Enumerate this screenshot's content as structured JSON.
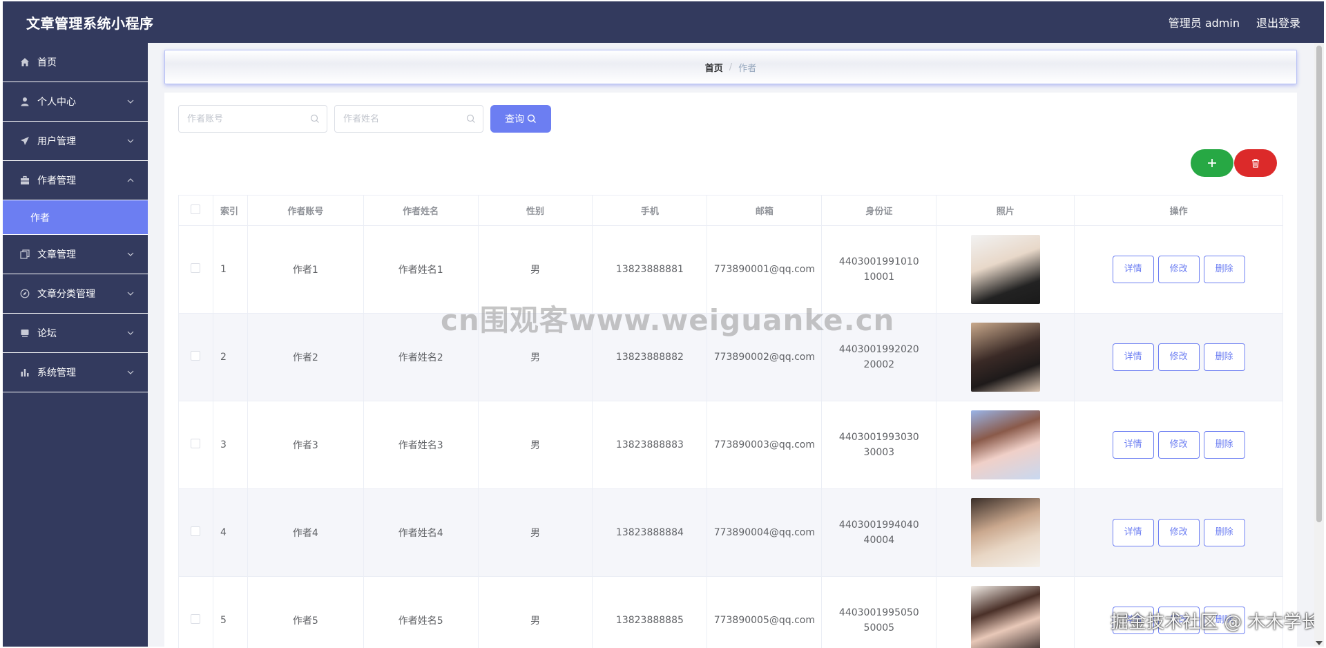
{
  "header": {
    "app_title": "文章管理系统小程序",
    "admin_label": "管理员 admin",
    "logout_label": "退出登录"
  },
  "sidebar": {
    "items": [
      {
        "label": "首页",
        "icon": "home-icon",
        "has_chevron": false
      },
      {
        "label": "个人中心",
        "icon": "user-icon",
        "has_chevron": true,
        "expanded": false
      },
      {
        "label": "用户管理",
        "icon": "paper-plane-icon",
        "has_chevron": true,
        "expanded": false
      },
      {
        "label": "作者管理",
        "icon": "briefcase-icon",
        "has_chevron": true,
        "expanded": true
      },
      {
        "label": "文章管理",
        "icon": "copy-icon",
        "has_chevron": true,
        "expanded": false
      },
      {
        "label": "文章分类管理",
        "icon": "compass-icon",
        "has_chevron": true,
        "expanded": false
      },
      {
        "label": "论坛",
        "icon": "stack-icon",
        "has_chevron": true,
        "expanded": false
      },
      {
        "label": "系统管理",
        "icon": "bar-chart-icon",
        "has_chevron": true,
        "expanded": false
      }
    ],
    "active_sub_item": "作者"
  },
  "breadcrumb": {
    "home": "首页",
    "separator": "/",
    "current": "作者"
  },
  "search": {
    "account_placeholder": "作者账号",
    "name_placeholder": "作者姓名",
    "query_label": "查询"
  },
  "table": {
    "columns": [
      "索引",
      "作者账号",
      "作者姓名",
      "性别",
      "手机",
      "邮箱",
      "身份证",
      "照片",
      "操作"
    ],
    "rows": [
      {
        "index": "1",
        "account": "作者1",
        "name": "作者姓名1",
        "gender": "男",
        "phone": "13823888881",
        "email": "773890001@qq.com",
        "id_card": "440300199101010001"
      },
      {
        "index": "2",
        "account": "作者2",
        "name": "作者姓名2",
        "gender": "男",
        "phone": "13823888882",
        "email": "773890002@qq.com",
        "id_card": "440300199202020002"
      },
      {
        "index": "3",
        "account": "作者3",
        "name": "作者姓名3",
        "gender": "男",
        "phone": "13823888883",
        "email": "773890003@qq.com",
        "id_card": "440300199303030003"
      },
      {
        "index": "4",
        "account": "作者4",
        "name": "作者姓名4",
        "gender": "男",
        "phone": "13823888884",
        "email": "773890004@qq.com",
        "id_card": "440300199404040004"
      },
      {
        "index": "5",
        "account": "作者5",
        "name": "作者姓名5",
        "gender": "男",
        "phone": "13823888885",
        "email": "773890005@qq.com",
        "id_card": "440300199505050005"
      }
    ],
    "actions": {
      "detail": "详情",
      "edit": "修改",
      "delete": "删除"
    }
  },
  "watermarks": {
    "center": "cn围观客www.weiguanke.cn",
    "corner": "掘金技术社区 @ 木木学长"
  },
  "colors": {
    "header_bg": "#333a5e",
    "sidebar_bg": "#333a5e",
    "accent": "#6c7ef2",
    "add_button": "#27a844",
    "delete_button": "#dc2a2a"
  }
}
